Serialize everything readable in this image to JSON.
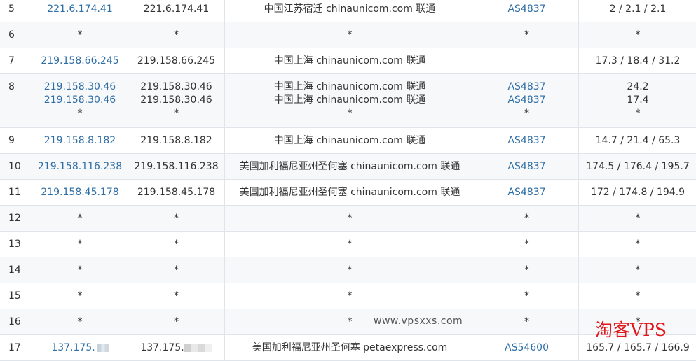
{
  "rows": [
    {
      "hop": "5",
      "ip": "221.6.174.41",
      "host": "221.6.174.41",
      "loc": "中国江苏宿迁 chinaunicom.com 联通",
      "asn": "AS4837",
      "rtt": "2 / 2.1 / 2.1"
    },
    {
      "hop": "6",
      "ip": "*",
      "host": "*",
      "loc": "*",
      "asn": "*",
      "rtt": "*"
    },
    {
      "hop": "7",
      "ip": "219.158.66.245",
      "host": "219.158.66.245",
      "loc": "中国上海 chinaunicom.com 联通",
      "asn": "",
      "rtt": "17.3 / 18.4 / 31.2"
    },
    {
      "hop": "8",
      "ip": [
        "219.158.30.46",
        "219.158.30.46",
        "*"
      ],
      "host": [
        "219.158.30.46",
        "219.158.30.46",
        "*"
      ],
      "loc": [
        "中国上海 chinaunicom.com 联通",
        "中国上海 chinaunicom.com 联通",
        "*"
      ],
      "asn": [
        "AS4837",
        "AS4837",
        "*"
      ],
      "rtt": [
        "24.2",
        "17.4",
        "*"
      ]
    },
    {
      "hop": "9",
      "ip": "219.158.8.182",
      "host": "219.158.8.182",
      "loc": "中国上海 chinaunicom.com 联通",
      "asn": "AS4837",
      "rtt": "14.7 / 21.4 / 65.3"
    },
    {
      "hop": "10",
      "ip": "219.158.116.238",
      "host": "219.158.116.238",
      "loc": "美国加利福尼亚州圣何塞 chinaunicom.com 联通",
      "asn": "AS4837",
      "rtt": "174.5 / 176.4 / 195.7"
    },
    {
      "hop": "11",
      "ip": "219.158.45.178",
      "host": "219.158.45.178",
      "loc": "美国加利福尼亚州圣何塞 chinaunicom.com 联通",
      "asn": "AS4837",
      "rtt": "172 / 174.8 / 194.9"
    },
    {
      "hop": "12",
      "ip": "*",
      "host": "*",
      "loc": "*",
      "asn": "*",
      "rtt": "*"
    },
    {
      "hop": "13",
      "ip": "*",
      "host": "*",
      "loc": "*",
      "asn": "*",
      "rtt": "*"
    },
    {
      "hop": "14",
      "ip": "*",
      "host": "*",
      "loc": "*",
      "asn": "*",
      "rtt": "*"
    },
    {
      "hop": "15",
      "ip": "*",
      "host": "*",
      "loc": "*",
      "asn": "*",
      "rtt": "*"
    },
    {
      "hop": "16",
      "ip": "*",
      "host": "*",
      "loc": "*",
      "asn": "*",
      "rtt": "*"
    },
    {
      "hop": "17",
      "ip": "137.175.",
      "host": "137.175.",
      "loc": "美国加利福尼亚州圣何塞 petaexpress.com",
      "asn": "AS54600",
      "rtt": "165.7 / 165.7 / 166.9"
    }
  ],
  "watermark": "www.vpsxxs.com",
  "brand": "淘客VPS",
  "colors": {
    "link": "#2f6ea5",
    "border": "#dfe4ea",
    "stripe": "#f7f8fa",
    "brand": "#e0161b"
  }
}
